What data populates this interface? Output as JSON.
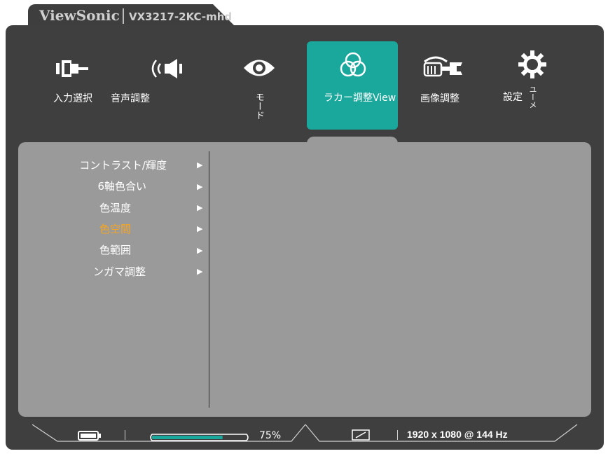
{
  "brand": {
    "name": "ViewSonic",
    "model": "VX3217-2KC-mhd"
  },
  "menu": [
    {
      "label": "入力選択",
      "icon": "input-select-icon"
    },
    {
      "label": "音声調整",
      "icon": "audio-icon"
    },
    {
      "label": "モード",
      "icon": "eye-icon"
    },
    {
      "label": "ラカー調整View",
      "icon": "color-circles-icon",
      "active": true
    },
    {
      "label": "画像調整",
      "icon": "image-adjust-icon"
    },
    {
      "label": "設定ユーメ",
      "icon": "gear-icon"
    }
  ],
  "submenu": [
    {
      "label": "コントラスト/輝度"
    },
    {
      "label": "6軸色合い"
    },
    {
      "label": "色温度"
    },
    {
      "label": "色空間",
      "selected": true
    },
    {
      "label": "色範囲"
    },
    {
      "label": "ンガマ調整"
    }
  ],
  "status": {
    "volume": 75,
    "volume_label": "75%",
    "resolution": "1920 x 1080 @ 144 Hz"
  },
  "colors": {
    "accent": "#1aa79c",
    "selected_text": "#f5a623",
    "panel": "#3f3f3f",
    "content": "#9a9a9a"
  }
}
